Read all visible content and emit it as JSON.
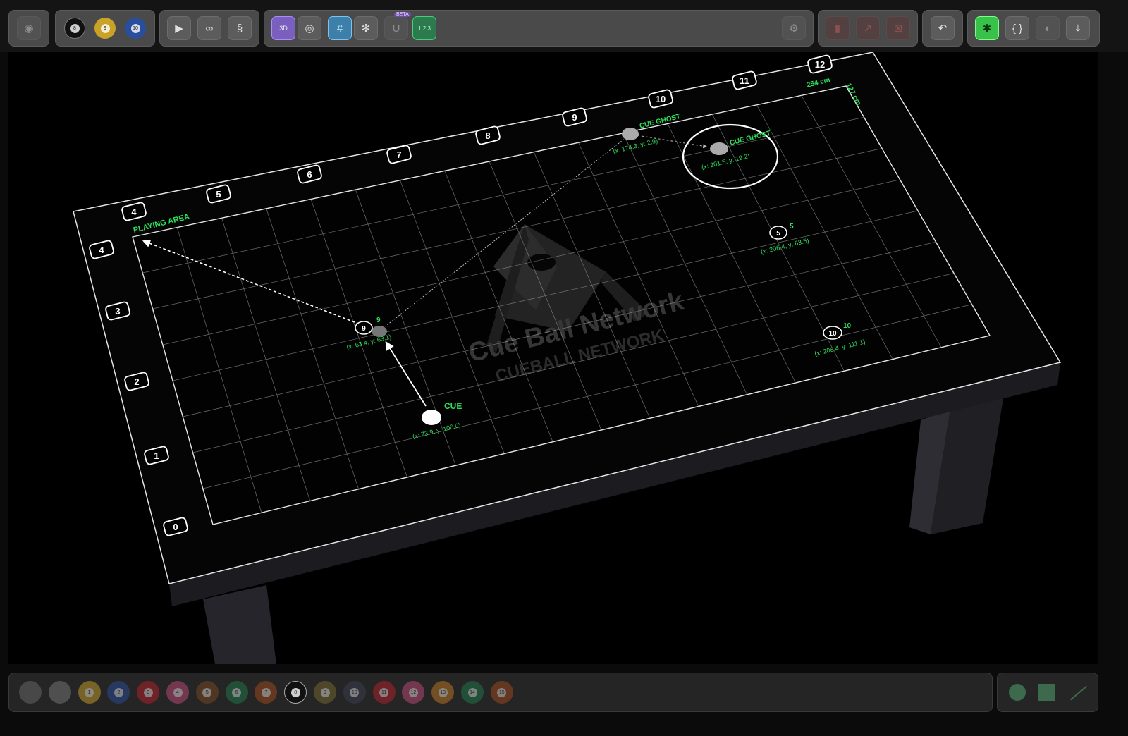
{
  "toolbar": {
    "icons": {
      "eye": "eye-icon",
      "play": "play-icon",
      "link": "link-icon",
      "route": "route-icon",
      "view3d": "3D",
      "camera": "camera-icon",
      "grid": "grid-icon",
      "settings": "gear-icon",
      "magnet": "magnet-icon",
      "fraction": "1 2 3",
      "beta": "BETA",
      "undo": "undo-icon",
      "bug": "bug-icon",
      "braces": "{ }",
      "contrast": "contrast-icon",
      "download": "download-icon"
    }
  },
  "table": {
    "playing_area_label": "PLAYING AREA",
    "length_label": "254 cm",
    "width_label": "127 cm",
    "rail_top": [
      "4",
      "5",
      "6",
      "7",
      "8",
      "9",
      "10",
      "11",
      "12"
    ],
    "rail_left": [
      "4",
      "3",
      "2",
      "1",
      "0"
    ],
    "watermark_title": "Cue Ball Network",
    "watermark_sub": "CUEBALL NETWORK"
  },
  "balls": [
    {
      "id": "cue",
      "label": "CUE",
      "coords": "(x: 73.9, y: 106.0)"
    },
    {
      "id": "ball9",
      "num": "9",
      "label": "9",
      "coords": "(x: 63.4, y: 63.1)"
    },
    {
      "id": "ghost1",
      "label": "CUE GHOST",
      "coords": "(x: 174.3, y: 2.9)"
    },
    {
      "id": "ghost2",
      "label": "CUE GHOST",
      "coords": "(x: 201.5, y: 19.2)"
    },
    {
      "id": "ball5",
      "num": "5",
      "label": "5",
      "coords": "(x: 206.4, y: 63.5)"
    },
    {
      "id": "ball10",
      "num": "10",
      "label": "10",
      "coords": "(x: 206.4, y: 111.1)"
    }
  ],
  "palette": {
    "balls": [
      {
        "num": "",
        "color": "#6b6b6b"
      },
      {
        "num": "",
        "color": "#7a7a7a"
      },
      {
        "num": "1",
        "color": "#c9a227"
      },
      {
        "num": "2",
        "color": "#2a4e9e"
      },
      {
        "num": "3",
        "color": "#b8232c"
      },
      {
        "num": "4",
        "color": "#c04a7a"
      },
      {
        "num": "5",
        "color": "#7a4a23"
      },
      {
        "num": "6",
        "color": "#1f7a4a"
      },
      {
        "num": "7",
        "color": "#a34a1e"
      },
      {
        "num": "8",
        "color": "#111111"
      },
      {
        "num": "9",
        "color": "#7a6a30"
      },
      {
        "num": "10",
        "color": "#3a3f52"
      },
      {
        "num": "11",
        "color": "#b8232c"
      },
      {
        "num": "12",
        "color": "#c04a7a"
      },
      {
        "num": "13",
        "color": "#c07a23"
      },
      {
        "num": "14",
        "color": "#1f7a4a"
      },
      {
        "num": "15",
        "color": "#a34a1e"
      }
    ],
    "shapes": [
      "circle-icon",
      "square-icon",
      "line-icon"
    ]
  },
  "colors": {
    "accent_green": "#2ee05a"
  }
}
